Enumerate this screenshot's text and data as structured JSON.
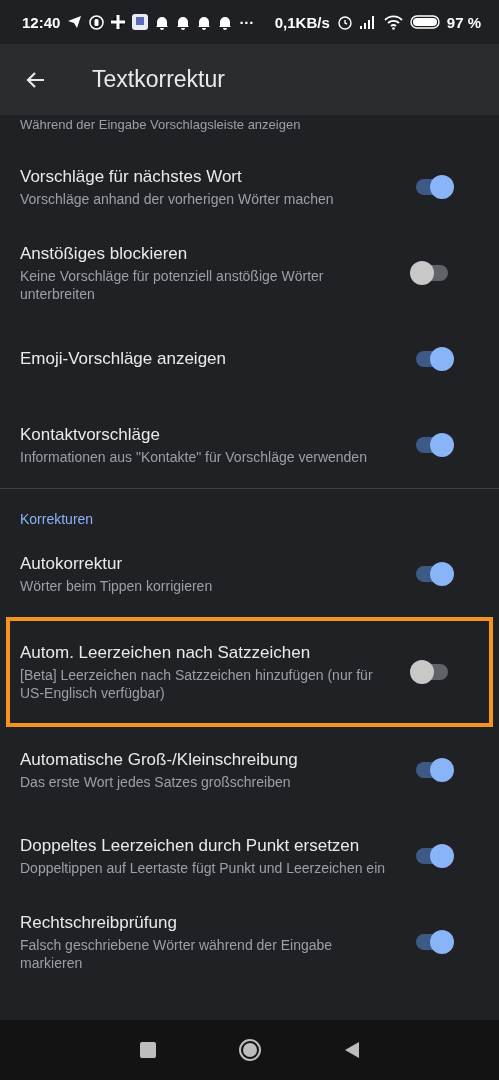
{
  "status_bar": {
    "time": "12:40",
    "more": "···",
    "speed": "0,1KB/s",
    "battery": "97 %"
  },
  "app_bar": {
    "title": "Textkorrektur"
  },
  "partial_subtitle": "Während der Eingabe Vorschlagsleiste anzeigen",
  "sections": [
    {
      "items": [
        {
          "title": "Vorschläge für nächstes Wort",
          "subtitle": "Vorschläge anhand der vorherigen Wörter machen",
          "on": true
        },
        {
          "title": "Anstößiges blockieren",
          "subtitle": "Keine Vorschläge für potenziell anstößige Wörter unterbreiten",
          "on": false
        },
        {
          "title": "Emoji-Vorschläge anzeigen",
          "on": true
        },
        {
          "title": "Kontaktvorschläge",
          "subtitle": "Informationen aus \"Kontakte\" für Vorschläge verwenden",
          "on": true
        }
      ]
    },
    {
      "header": "Korrekturen",
      "items": [
        {
          "title": "Autokorrektur",
          "subtitle": "Wörter beim Tippen korrigieren",
          "on": true
        },
        {
          "title": "Autom. Leerzeichen nach Satzzeichen",
          "subtitle": "[Beta] Leerzeichen nach Satzzeichen hinzufügen (nur für US-Englisch verfügbar)",
          "on": false,
          "highlighted": true
        },
        {
          "title": "Automatische Groß-/Kleinschreibung",
          "subtitle": "Das erste Wort jedes Satzes großschreiben",
          "on": true
        },
        {
          "title": "Doppeltes Leerzeichen durch Punkt ersetzen",
          "subtitle": "Doppeltippen auf Leertaste fügt Punkt und Leerzeichen ein",
          "on": true
        },
        {
          "title": "Rechtschreibprüfung",
          "subtitle": "Falsch geschriebene Wörter während der Eingabe markieren",
          "on": true
        }
      ]
    }
  ]
}
